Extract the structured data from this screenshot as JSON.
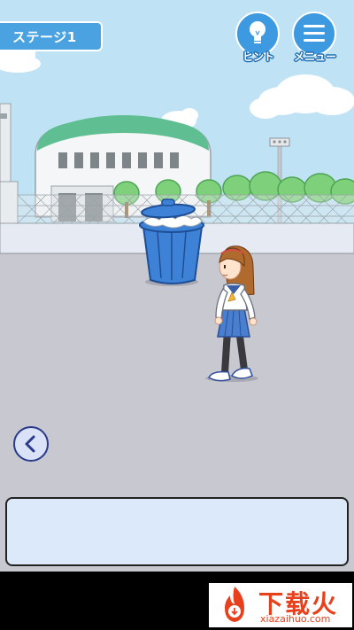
{
  "game": {
    "stage_label": "ステージ1",
    "hint_label": "ヒント",
    "menu_label": "メニュー",
    "message_text": ""
  },
  "watermark": {
    "brand": "下载火",
    "url": "xiazaihuo.com"
  },
  "colors": {
    "sky": "#bfe3f5",
    "ground": "#c8c8d0",
    "button_blue": "#3e9ae0",
    "stage_blue": "#4aa3e0",
    "trash_can": "#3d82d6",
    "message_box": "#dbe9fb"
  },
  "icons": {
    "hint": "lightbulb-icon",
    "menu": "hamburger-menu-icon",
    "back": "chevron-left-icon"
  }
}
